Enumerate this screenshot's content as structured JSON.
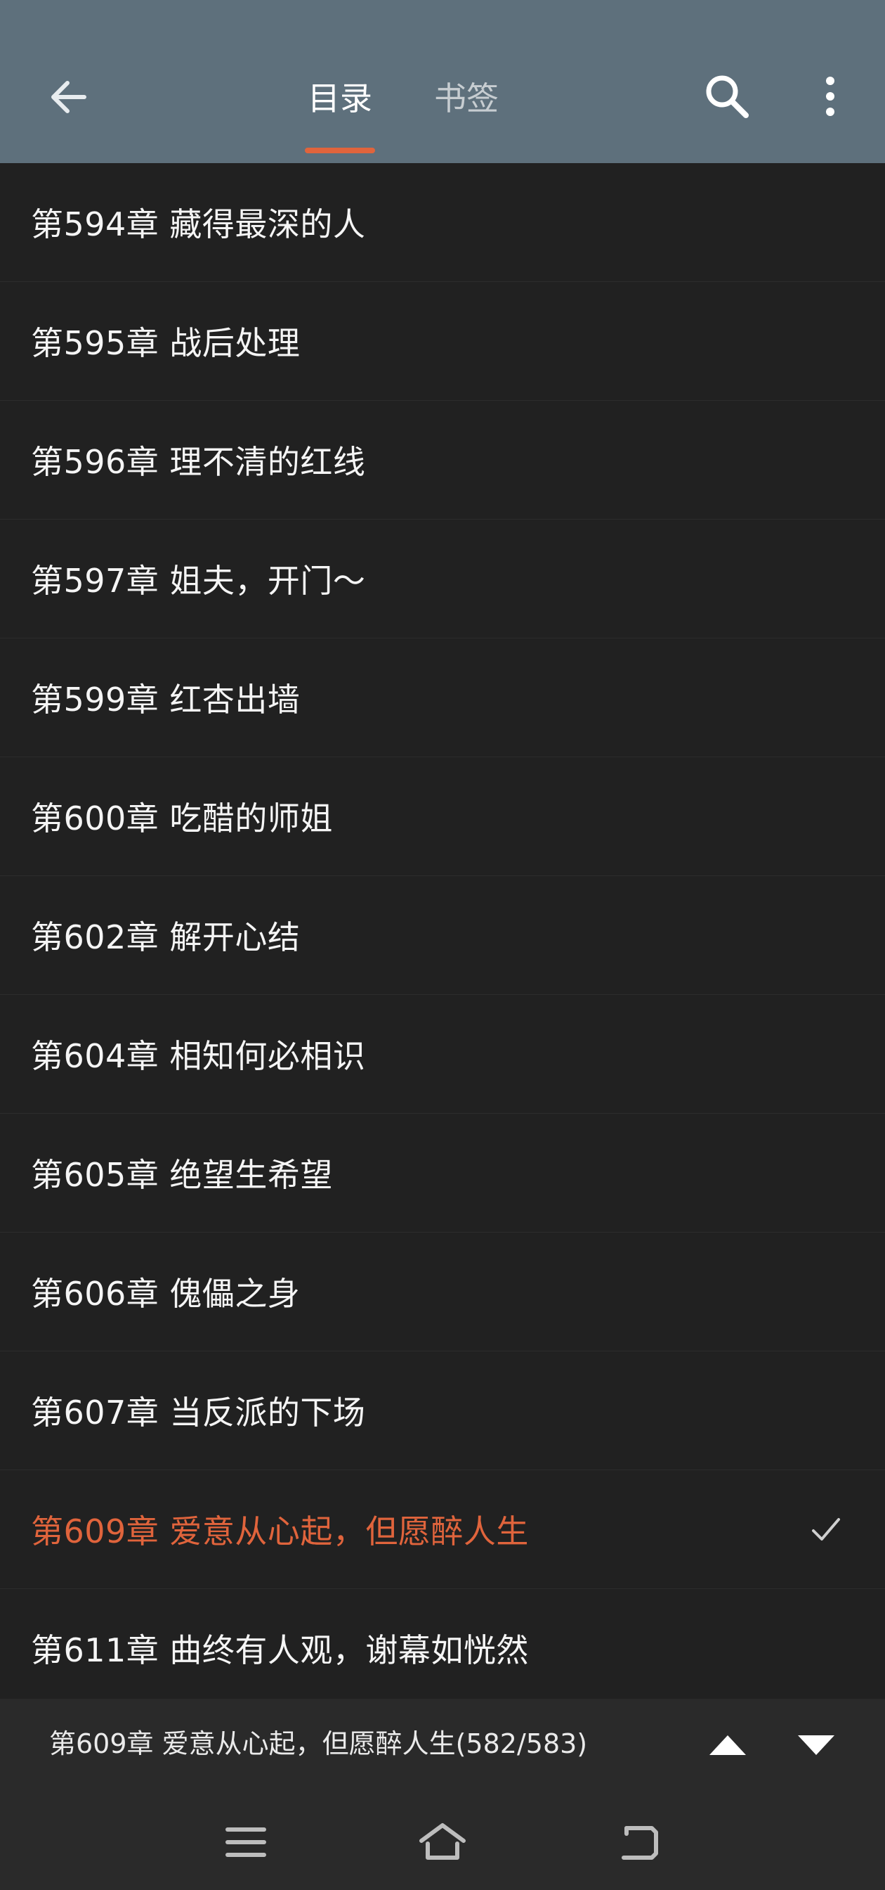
{
  "colors": {
    "header_bg": "#5e707c",
    "list_bg": "#212121",
    "accent": "#e0643c",
    "text": "#f5f5f5"
  },
  "header": {
    "back_icon": "arrow-left-icon",
    "tabs": [
      {
        "label": "目录",
        "active": true
      },
      {
        "label": "书签",
        "active": false
      }
    ],
    "search_icon": "search-icon",
    "more_icon": "more-vertical-icon"
  },
  "chapters": [
    {
      "title": "第594章  藏得最深的人"
    },
    {
      "title": "第595章  战后处理"
    },
    {
      "title": "第596章  理不清的红线"
    },
    {
      "title": "第597章  姐夫，开门～"
    },
    {
      "title": "第599章  红杏出墙"
    },
    {
      "title": "第600章   吃醋的师姐"
    },
    {
      "title": "第602章  解开心结"
    },
    {
      "title": "第604章  相知何必相识"
    },
    {
      "title": "第605章  绝望生希望"
    },
    {
      "title": "第606章  傀儡之身"
    },
    {
      "title": "第607章  当反派的下场"
    },
    {
      "title": "第609章  爱意从心起，但愿醉人生",
      "current": true
    },
    {
      "title": "第611章  曲终有人观，谢幕如恍然"
    }
  ],
  "bottom_bar": {
    "current_chapter": "第609章  爱意从心起，但愿醉人生(582/583)",
    "up_icon": "triangle-up-icon",
    "down_icon": "triangle-down-icon"
  },
  "nav": {
    "menu_icon": "menu-icon",
    "home_icon": "home-icon",
    "back_icon": "back-icon"
  }
}
